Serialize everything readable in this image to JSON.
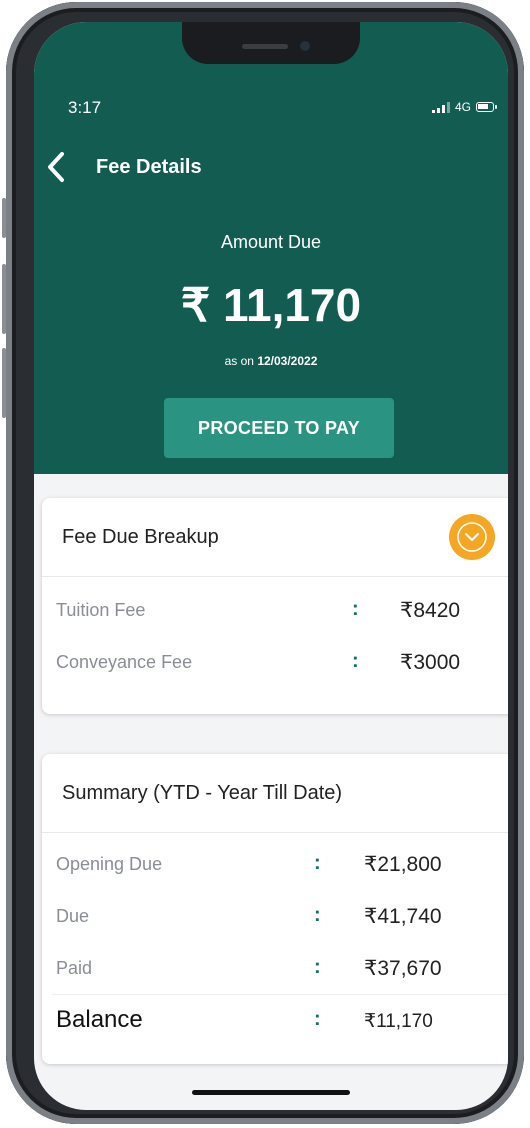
{
  "status_bar": {
    "time": "3:17",
    "network": "4G"
  },
  "header": {
    "back_icon": "chevron-left-icon",
    "title": "Fee Details"
  },
  "amount": {
    "label": "Amount Due",
    "value": "₹ 11,170",
    "as_on_prefix": "as on",
    "as_on_date": "12/03/2022"
  },
  "pay_button": {
    "label": "PROCEED TO PAY"
  },
  "fee_breakup": {
    "title": "Fee Due Breakup",
    "toggle_icon": "chevron-down-icon",
    "rows": [
      {
        "label": "Tuition Fee",
        "separator": ":",
        "value": "₹8420"
      },
      {
        "label": "Conveyance Fee",
        "separator": ":",
        "value": "₹3000"
      }
    ]
  },
  "summary": {
    "title": "Summary (YTD - Year Till Date)",
    "rows": [
      {
        "label": "Opening Due",
        "separator": ":",
        "value": "₹21,800"
      },
      {
        "label": "Due",
        "separator": ":",
        "value": "₹41,740"
      },
      {
        "label": "Paid",
        "separator": ":",
        "value": "₹37,670"
      },
      {
        "label": "Balance",
        "separator": ":",
        "value": "₹11,170"
      }
    ]
  },
  "colors": {
    "header_bg": "#125c52",
    "button_bg": "#2a9382",
    "toggle_bg": "#f5a623",
    "colon": "#136f62"
  }
}
